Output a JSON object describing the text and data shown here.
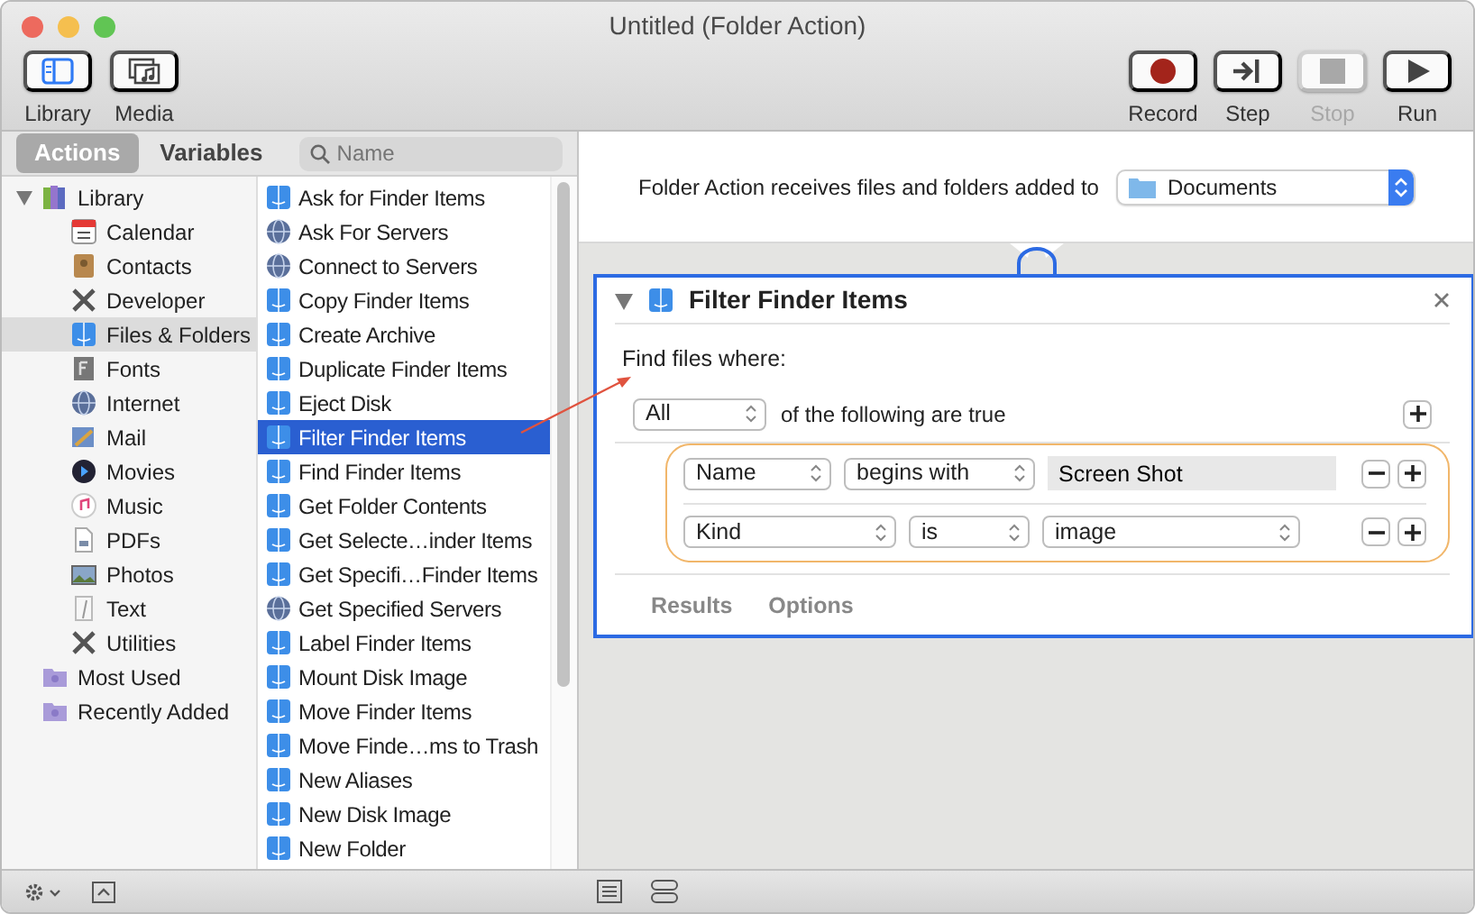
{
  "window": {
    "title": "Untitled (Folder Action)"
  },
  "toolbar": {
    "left": [
      {
        "label": "Library",
        "kind": "library"
      },
      {
        "label": "Media",
        "kind": "media"
      }
    ],
    "right": [
      {
        "label": "Record",
        "kind": "record",
        "disabled": false
      },
      {
        "label": "Step",
        "kind": "step",
        "disabled": false
      },
      {
        "label": "Stop",
        "kind": "stop",
        "disabled": true
      },
      {
        "label": "Run",
        "kind": "run",
        "disabled": false
      }
    ]
  },
  "library_tabs": [
    {
      "label": "Actions",
      "selected": true
    },
    {
      "label": "Variables",
      "selected": false
    }
  ],
  "search": {
    "placeholder": "Name"
  },
  "library": [
    {
      "label": "Library",
      "kind": "library",
      "selected": false,
      "expanded": true,
      "children": [
        {
          "label": "Calendar",
          "kind": "calendar",
          "selected": false
        },
        {
          "label": "Contacts",
          "kind": "contacts",
          "selected": false
        },
        {
          "label": "Developer",
          "kind": "tools",
          "selected": false
        },
        {
          "label": "Files & Folders",
          "kind": "finder",
          "selected": true
        },
        {
          "label": "Fonts",
          "kind": "fonts",
          "selected": false
        },
        {
          "label": "Internet",
          "kind": "globe",
          "selected": false
        },
        {
          "label": "Mail",
          "kind": "mail",
          "selected": false
        },
        {
          "label": "Movies",
          "kind": "movies",
          "selected": false
        },
        {
          "label": "Music",
          "kind": "music",
          "selected": false
        },
        {
          "label": "PDFs",
          "kind": "pdf",
          "selected": false
        },
        {
          "label": "Photos",
          "kind": "photos",
          "selected": false
        },
        {
          "label": "Text",
          "kind": "text",
          "selected": false
        },
        {
          "label": "Utilities",
          "kind": "tools",
          "selected": false
        }
      ]
    },
    {
      "label": "Most Used",
      "kind": "smart-folder",
      "selected": false
    },
    {
      "label": "Recently Added",
      "kind": "smart-folder",
      "selected": false
    }
  ],
  "actions": [
    {
      "label": "Ask for Finder Items",
      "kind": "finder",
      "selected": false
    },
    {
      "label": "Ask For Servers",
      "kind": "globe",
      "selected": false
    },
    {
      "label": "Connect to Servers",
      "kind": "globe",
      "selected": false
    },
    {
      "label": "Copy Finder Items",
      "kind": "finder",
      "selected": false
    },
    {
      "label": "Create Archive",
      "kind": "finder",
      "selected": false
    },
    {
      "label": "Duplicate Finder Items",
      "kind": "finder",
      "selected": false
    },
    {
      "label": "Eject Disk",
      "kind": "finder",
      "selected": false
    },
    {
      "label": "Filter Finder Items",
      "kind": "finder",
      "selected": true
    },
    {
      "label": "Find Finder Items",
      "kind": "finder",
      "selected": false
    },
    {
      "label": "Get Folder Contents",
      "kind": "finder",
      "selected": false
    },
    {
      "label": "Get Selecte…inder Items",
      "kind": "finder",
      "selected": false
    },
    {
      "label": "Get Specifi…Finder Items",
      "kind": "finder",
      "selected": false
    },
    {
      "label": "Get Specified Servers",
      "kind": "globe",
      "selected": false
    },
    {
      "label": "Label Finder Items",
      "kind": "finder",
      "selected": false
    },
    {
      "label": "Mount Disk Image",
      "kind": "finder",
      "selected": false
    },
    {
      "label": "Move Finder Items",
      "kind": "finder",
      "selected": false
    },
    {
      "label": "Move Finde…ms to Trash",
      "kind": "finder",
      "selected": false
    },
    {
      "label": "New Aliases",
      "kind": "finder",
      "selected": false
    },
    {
      "label": "New Disk Image",
      "kind": "finder",
      "selected": false
    },
    {
      "label": "New Folder",
      "kind": "finder",
      "selected": false
    }
  ],
  "workflow": {
    "receives_label": "Folder Action receives files and folders added to",
    "folder": "Documents"
  },
  "action_card": {
    "title": "Filter Finder Items",
    "expanded": true,
    "prompt": "Find files where:",
    "match": "All",
    "match_suffix": "of the following are true",
    "conditions": [
      {
        "field": "Name",
        "operator": "begins with",
        "kind": "text",
        "value": "Screen Shot"
      },
      {
        "field": "Kind",
        "operator": "is",
        "kind": "menu",
        "value": "image"
      }
    ],
    "tabs": [
      {
        "label": "Results",
        "selected": false
      },
      {
        "label": "Options",
        "selected": false
      }
    ]
  }
}
